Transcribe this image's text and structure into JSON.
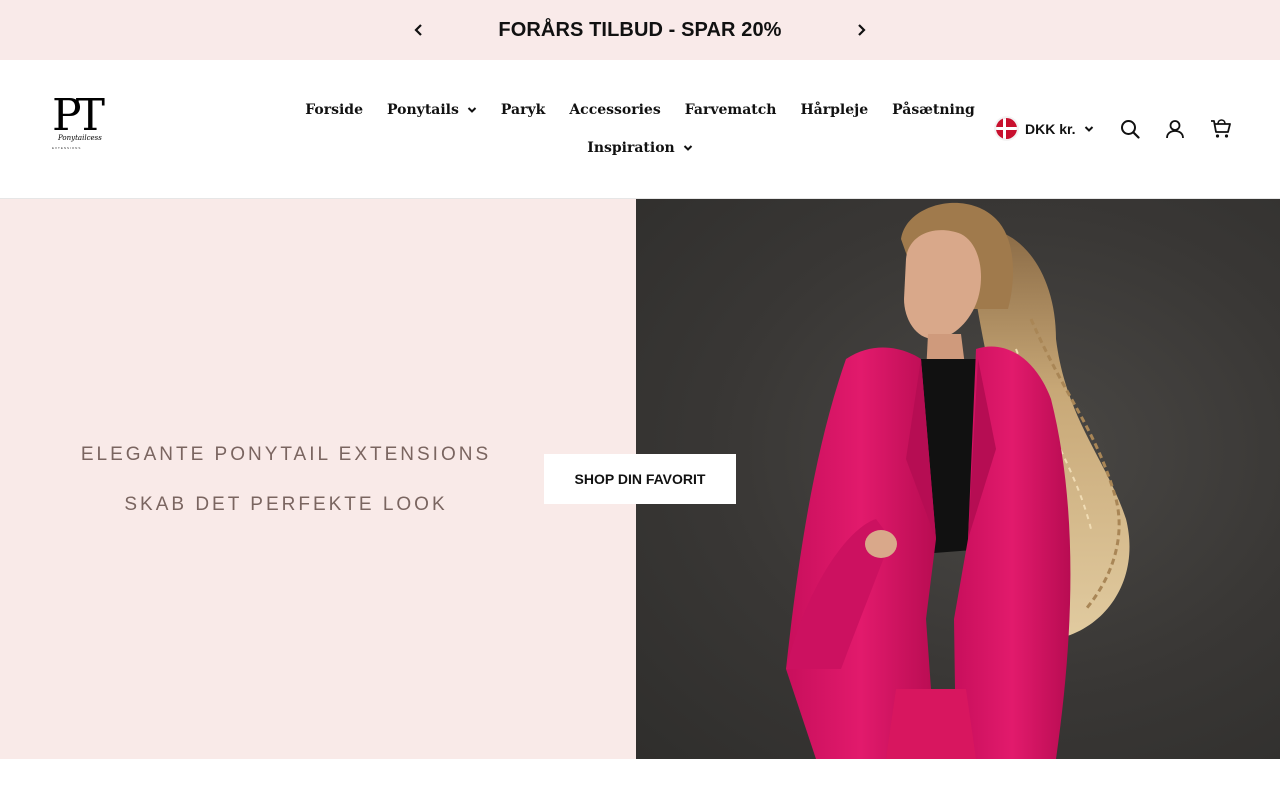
{
  "announcement": {
    "message": "FORÅRS TILBUD - SPAR 20%",
    "prev_icon": "chevron-left-icon",
    "next_icon": "chevron-right-icon"
  },
  "header": {
    "logo": {
      "monogram": "PT",
      "subtitle": "Ponytailcess",
      "tagline": "EXTENSIONS"
    },
    "nav_row1": [
      {
        "label": "Forside",
        "has_dropdown": false
      },
      {
        "label": "Ponytails",
        "has_dropdown": true
      },
      {
        "label": "Paryk",
        "has_dropdown": false
      },
      {
        "label": "Accessories",
        "has_dropdown": false
      },
      {
        "label": "Farvematch",
        "has_dropdown": false
      },
      {
        "label": "Hårpleje",
        "has_dropdown": false
      },
      {
        "label": "Påsætning",
        "has_dropdown": false
      }
    ],
    "nav_row2": [
      {
        "label": "Inspiration",
        "has_dropdown": true
      }
    ],
    "currency": {
      "label": "DKK kr.",
      "flag": "denmark-flag-icon"
    },
    "icons": [
      "search-icon",
      "account-icon",
      "cart-icon"
    ]
  },
  "hero": {
    "tagline_1": "ELEGANTE PONYTAIL EXTENSIONS",
    "tagline_2": "SKAB DET PERFEKTE LOOK",
    "cta_label": "SHOP DIN FAVORIT"
  },
  "colors": {
    "announcement_bg": "#f9eae9",
    "hero_left_bg": "#f9eae8",
    "tagline_text": "#7a6560",
    "blazer_pink": "#e0186a",
    "backdrop_dark": "#393735"
  }
}
